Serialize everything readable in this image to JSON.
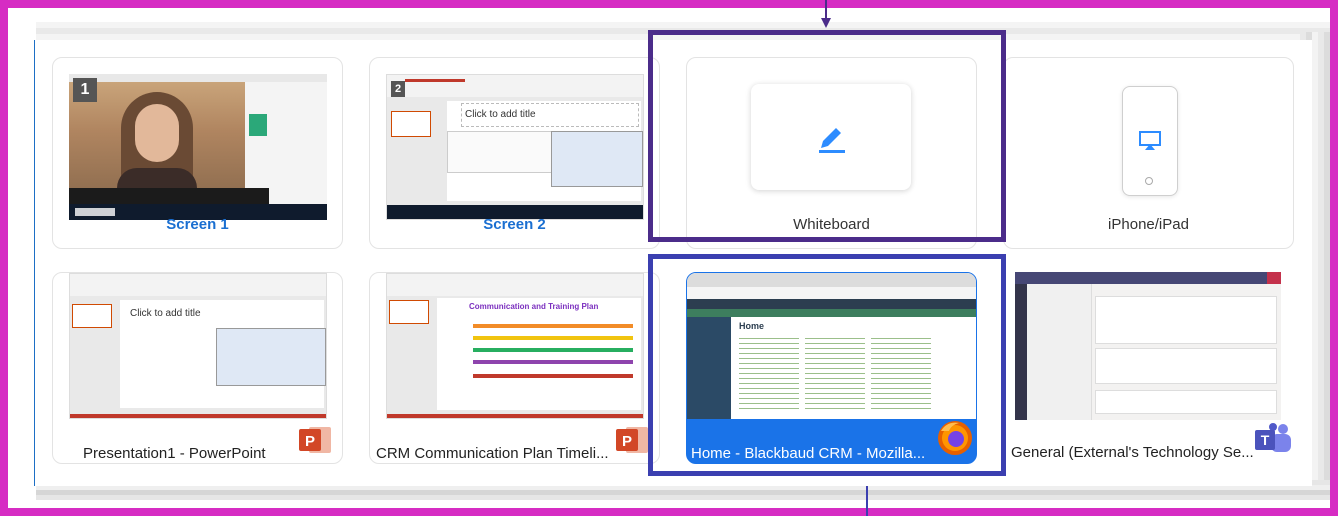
{
  "share_options": [
    {
      "label": "Screen 1",
      "number": "1"
    },
    {
      "label": "Screen 2",
      "number": "2"
    },
    {
      "label": "Whiteboard",
      "icon": "pen-icon"
    },
    {
      "label": "iPhone/iPad",
      "icon": "airplay-icon"
    },
    {
      "label": "Presentation1 - PowerPoint",
      "icon": "powerpoint-icon"
    },
    {
      "label": "CRM Communication Plan Timeli...",
      "icon": "powerpoint-icon"
    },
    {
      "label": "Home - Blackbaud CRM - Mozilla...",
      "icon": "firefox-icon",
      "selected": true
    },
    {
      "label": "General (External's Technology Se...",
      "icon": "teams-icon"
    }
  ],
  "thumbnails": {
    "slide_title": "Click to add title",
    "crm_plan_title": "Communication and Training Plan",
    "crm_home": "Home"
  },
  "colors": {
    "frame": "#d62cc3",
    "whiteboard_highlight": "#4b2c8a",
    "selection_highlight": "#3b3fb0",
    "accent": "#1a73e8"
  }
}
